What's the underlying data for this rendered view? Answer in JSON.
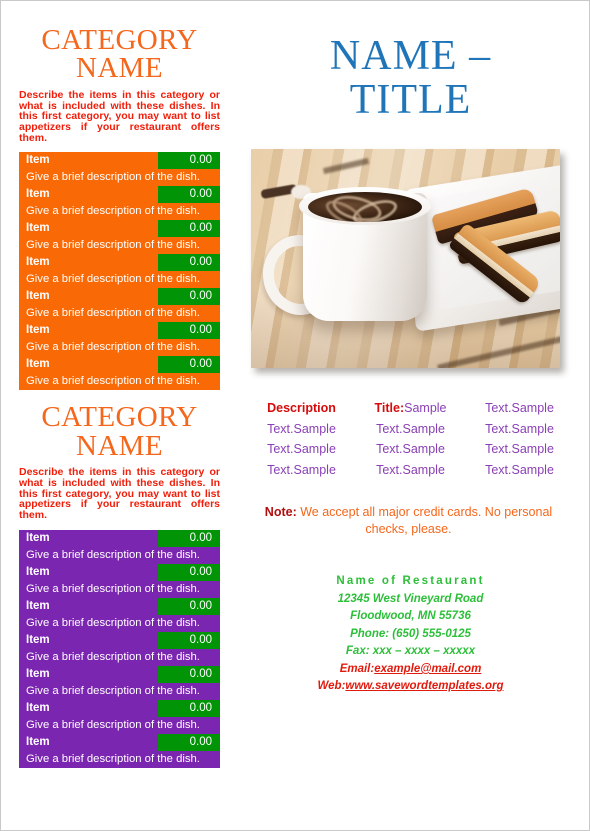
{
  "document": {
    "title": "Restaurant Menu Template"
  },
  "colors": {
    "orange": "#F96A07",
    "purple": "#7B26B0",
    "green_price": "#009406",
    "title_blue": "#1F75B8",
    "category_orange": "#F4671C",
    "desc_red": "#F01E0A",
    "sample_purple": "#8A3FB5",
    "sample_red": "#D60B0B",
    "footer_green": "#2DBF3A",
    "contact_red": "#E01B0E"
  },
  "left": {
    "categories": [
      {
        "title_line1": "CATEGORY",
        "title_line2": "NAME",
        "description": "Describe the items in this category or what is included with these dishes. In this first category, you may want to list appetizers if your restaurant offers them.",
        "theme": "orange",
        "items": [
          {
            "name": "Item",
            "price": "0.00",
            "description": "Give a brief description of the dish."
          },
          {
            "name": "Item",
            "price": "0.00",
            "description": "Give a brief description of the dish."
          },
          {
            "name": "Item",
            "price": "0.00",
            "description": "Give a brief description of the dish."
          },
          {
            "name": "Item",
            "price": "0.00",
            "description": "Give a brief description of the dish."
          },
          {
            "name": "Item",
            "price": "0.00",
            "description": "Give a brief description of the dish."
          },
          {
            "name": "Item",
            "price": "0.00",
            "description": "Give a brief description of the dish."
          },
          {
            "name": "Item",
            "price": "0.00",
            "description": "Give a brief description of the dish."
          }
        ]
      },
      {
        "title_line1": "CATEGORY",
        "title_line2": "NAME",
        "description": "Describe the items in this category or what is included with these dishes. In this first category, you may want to list appetizers if your restaurant offers them.",
        "theme": "purple",
        "items": [
          {
            "name": "Item",
            "price": "0.00",
            "description": "Give a brief description of the dish."
          },
          {
            "name": "Item",
            "price": "0.00",
            "description": "Give a brief description of the dish."
          },
          {
            "name": "Item",
            "price": "0.00",
            "description": "Give a brief description of the dish."
          },
          {
            "name": "Item",
            "price": "0.00",
            "description": "Give a brief description of the dish."
          },
          {
            "name": "Item",
            "price": "0.00",
            "description": "Give a brief description of the dish."
          },
          {
            "name": "Item",
            "price": "0.00",
            "description": "Give a brief description of the dish."
          },
          {
            "name": "Item",
            "price": "0.00",
            "description": "Give a brief description of the dish."
          }
        ]
      }
    ]
  },
  "right": {
    "main_title_line1": "NAME –",
    "main_title_line2": "TITLE",
    "photo": {
      "alt": "Cup of coffee with chocolate swirl and chocolate-dipped biscotti on a white plate"
    },
    "sample_grid": {
      "rows": [
        [
          {
            "lead": "Description",
            "tail": "",
            "style": "head"
          },
          {
            "lead": "Title:",
            "tail": "Sample",
            "style": "mixed"
          },
          {
            "lead": "",
            "tail": "Text.Sample",
            "style": "plain"
          }
        ],
        [
          {
            "lead": "",
            "tail": "Text.Sample",
            "style": "plain"
          },
          {
            "lead": "",
            "tail": "Text.Sample",
            "style": "plain"
          },
          {
            "lead": "",
            "tail": "Text.Sample",
            "style": "plain"
          }
        ],
        [
          {
            "lead": "",
            "tail": "Text.Sample",
            "style": "plain"
          },
          {
            "lead": "",
            "tail": "Text.Sample",
            "style": "plain"
          },
          {
            "lead": "",
            "tail": "Text.Sample",
            "style": "plain"
          }
        ],
        [
          {
            "lead": "",
            "tail": "Text.Sample",
            "style": "plain"
          },
          {
            "lead": "",
            "tail": "Text.Sample",
            "style": "plain"
          },
          {
            "lead": "",
            "tail": "Text.Sample",
            "style": "plain"
          }
        ]
      ]
    },
    "note": {
      "label": "Note:",
      "text": "We accept all major credit cards. No personal checks, please."
    },
    "footer": {
      "restaurant_name": "Name of Restaurant",
      "address_line1": "12345 West Vineyard Road",
      "address_line2": "Floodwood, MN 55736",
      "phone": "Phone: (650) 555-0125",
      "fax": "Fax: xxx – xxxx – xxxxx",
      "email_label": "Email:",
      "email_value": "example@mail.com",
      "web_label": "Web:",
      "web_value": "www.savewordtemplates.org"
    }
  }
}
